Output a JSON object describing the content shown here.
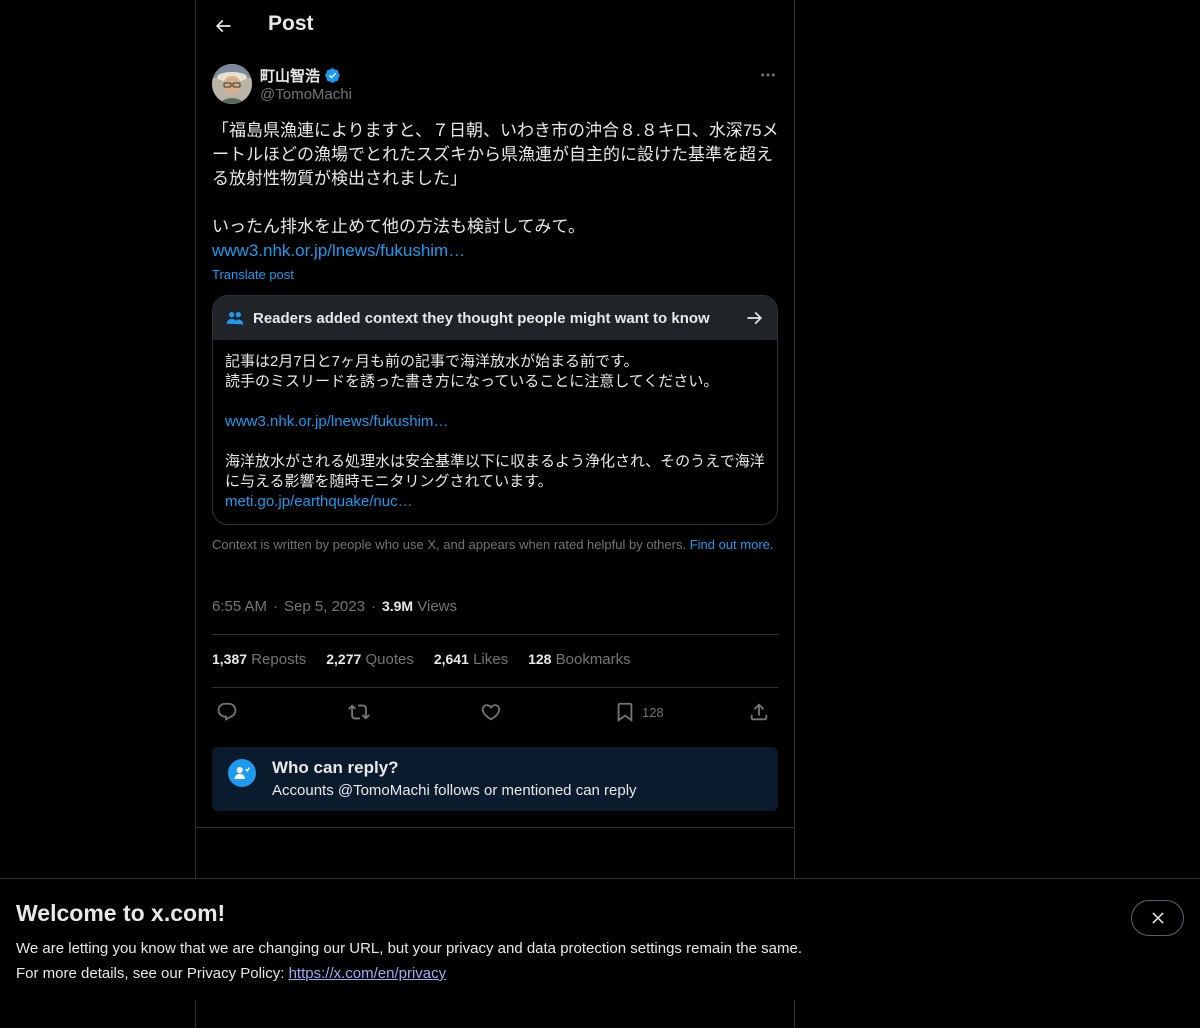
{
  "header": {
    "title": "Post"
  },
  "author": {
    "name": "町山智浩",
    "handle": "@TomoMachi"
  },
  "post": {
    "text": "「福島県漁連によりますと、７日朝、いわき市の沖合８.８キロ、水深75メートルほどの漁場でとれたスズキから県漁連が自主的に設けた基準を超える放射性物質が検出されました」\n\nいったん排水を止めて他の方法も検討してみて。",
    "link": "www3.nhk.or.jp/lnews/fukushim…",
    "translate": "Translate post"
  },
  "community_note": {
    "title": "Readers added context they thought people might want to know",
    "line1": "記事は2月7日と7ヶ月も前の記事で海洋放水が始まる前です。",
    "line2": "読手のミスリードを誘った書き方になっていることに注意してください。",
    "link1": "www3.nhk.or.jp/lnews/fukushim…",
    "line3": "海洋放水がされる処理水は安全基準以下に収まるよう浄化され、そのうえで海洋",
    "line4": "に与える影響を随時モニタリングされています。",
    "link2": "meti.go.jp/earthquake/nuc…",
    "disclaimer": "Context is written by people who use X, and appears when rated helpful by others.",
    "find_out_more": "Find out more."
  },
  "meta": {
    "time": "6:55 AM",
    "date": "Sep 5, 2023",
    "views_count": "3.9M",
    "views_label": "Views"
  },
  "stats": {
    "reposts_count": "1,387",
    "reposts_label": "Reposts",
    "quotes_count": "2,277",
    "quotes_label": "Quotes",
    "likes_count": "2,641",
    "likes_label": "Likes",
    "bookmarks_count": "128",
    "bookmarks_label": "Bookmarks"
  },
  "actions": {
    "bookmark_count": "128"
  },
  "who_can_reply": {
    "title": "Who can reply?",
    "desc": "Accounts @TomoMachi follows or mentioned can reply"
  },
  "banner": {
    "title": "Welcome to x.com!",
    "line1": "We are letting you know that we are changing our URL, but your privacy and data protection settings remain the same.",
    "line2_prefix": "For more details, see our Privacy Policy: ",
    "privacy_link": "https://x.com/en/privacy"
  },
  "colors": {
    "accent": "#1d9bf0",
    "background": "#000000",
    "text": "#e7e9ea",
    "muted": "#71767b",
    "border": "#2f3336"
  }
}
